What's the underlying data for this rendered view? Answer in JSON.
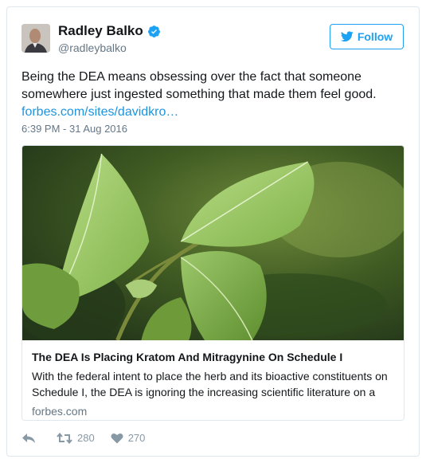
{
  "author": {
    "name": "Radley Balko",
    "handle": "@radleybalko"
  },
  "follow_label": "Follow",
  "tweet": {
    "text": "Being the DEA means obsessing over the fact that someone somewhere just ingested something that made them feel good.",
    "link": "forbes.com/sites/davidkro…",
    "timestamp": "6:39 PM - 31 Aug 2016"
  },
  "card": {
    "title": "The DEA Is Placing Kratom And Mitragynine On Schedule I",
    "description": "With the federal intent to place the herb and its bioactive constituents on Schedule I, the DEA is ignoring the increasing scientific literature on a",
    "domain": "forbes.com"
  },
  "actions": {
    "retweets": "280",
    "likes": "270"
  },
  "colors": {
    "accent": "#1da1f2",
    "link": "#1b95e0",
    "muted": "#657786"
  }
}
